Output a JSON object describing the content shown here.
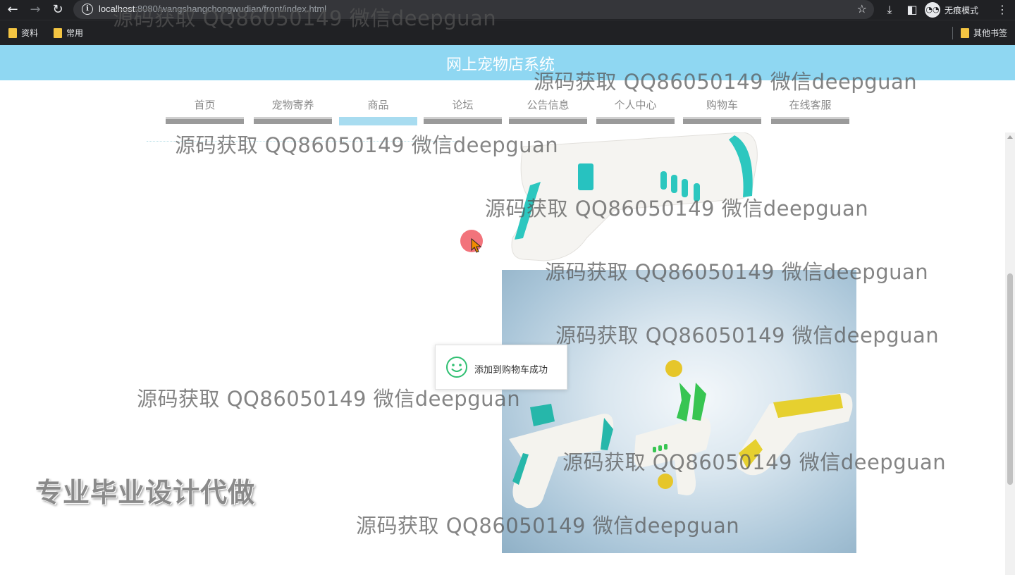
{
  "browser": {
    "url_host": "localhost",
    "url_rest": ":8080/wangshangchongwudian/front/index.html",
    "incognito_label": "无痕模式",
    "bookmarks": [
      "资料",
      "常用"
    ],
    "other_bookmarks": "其他书签"
  },
  "site": {
    "title": "网上宠物店系统",
    "nav": [
      {
        "label": "首页"
      },
      {
        "label": "宠物寄养"
      },
      {
        "label": "商品",
        "active": true
      },
      {
        "label": "论坛"
      },
      {
        "label": "公告信息"
      },
      {
        "label": "个人中心"
      },
      {
        "label": "购物车"
      },
      {
        "label": "在线客服"
      }
    ]
  },
  "toast": {
    "message": "添加到购物车成功"
  },
  "promo_text": "专业毕业设计代做",
  "watermarks": [
    "源码获取 QQ86050149 微信deepguan",
    "源码获取 QQ86050149 微信deepguan",
    "源码获取 QQ86050149 微信deepguan",
    "源码获取 QQ86050149 微信deepguan",
    "源码获取 QQ86050149 微信deepguan",
    "源码获取 QQ86050149 微信deepguan",
    "源码获取 QQ86050149 微信deepguan",
    "源码获取 QQ86050149 微信deepguan",
    "源码获取 QQ86050149 微信deepguan"
  ],
  "colors": {
    "header_bg": "#8fd7f2",
    "nav_active": "#a8dcf0",
    "toast_icon": "#2fbf71"
  }
}
